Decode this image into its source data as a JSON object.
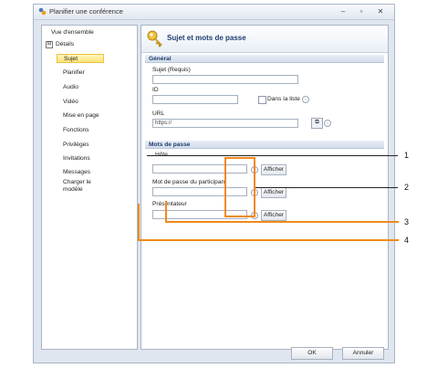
{
  "window": {
    "title": "Planifier une conférence",
    "controls": [
      "–",
      "▫",
      "✕"
    ]
  },
  "sidebar": {
    "items": [
      {
        "label": "Vue d'ensemble"
      },
      {
        "label": "Détails"
      },
      {
        "label": "Sujet"
      },
      {
        "label": "Planifier"
      },
      {
        "label": "Audio"
      },
      {
        "label": "Vidéo"
      },
      {
        "label": "Mise en page"
      },
      {
        "label": "Fonctions"
      },
      {
        "label": "Privilèges"
      },
      {
        "label": "Invitations"
      },
      {
        "label": "Messages"
      },
      {
        "label": "Charger le modèle"
      }
    ],
    "expander": "⊟"
  },
  "panel": {
    "title": "Sujet et mots de passe",
    "general": {
      "heading": "Général",
      "subject_label": "Sujet (Requis)",
      "subject_value": "",
      "id_label": "ID",
      "id_value": "",
      "in_list_label": "Dans la liste",
      "url_label": "URL",
      "url_value": "https://"
    },
    "passwords": {
      "heading": "Mots de passe",
      "host_label": "Hôte",
      "participant_label": "Mot de passe du participant",
      "presenter_label": "Présentateur",
      "show_label": "Afficher"
    },
    "info_glyph": "i"
  },
  "footer": {
    "ok_label": "OK",
    "cancel_label": "Annuler"
  },
  "callouts": [
    "1",
    "2",
    "3",
    "4"
  ],
  "colors": {
    "callout": "#f08a1c",
    "selected_bg": "#ffe37a",
    "heading": "#1e3c6c"
  }
}
